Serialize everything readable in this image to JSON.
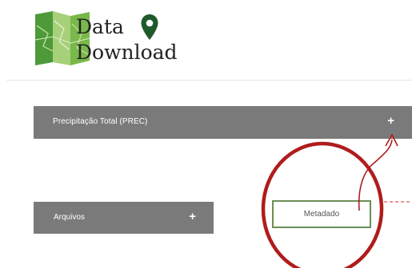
{
  "logo": {
    "line1": "Data",
    "line2": "Download",
    "map_icon": "folded-map-icon",
    "pin_icon": "map-pin-icon"
  },
  "accordion_main": {
    "label": "Precipitação Total (PREC)",
    "expand_symbol": "+"
  },
  "accordion_files": {
    "label": "Arquivos",
    "expand_symbol": "+"
  },
  "metadata_button": {
    "label": "Metadado"
  },
  "annotation": {
    "circle_color": "#b01c1c",
    "arrow_color": "#b01c1c",
    "dash_color": "#d9534f"
  },
  "colors": {
    "accordion_bg": "#7a7a7a",
    "button_border": "#6b8e55",
    "map_greens": [
      "#4e9a3a",
      "#79b84a",
      "#a7d07a",
      "#c8e39e"
    ],
    "pin": "#1f5a2c"
  }
}
